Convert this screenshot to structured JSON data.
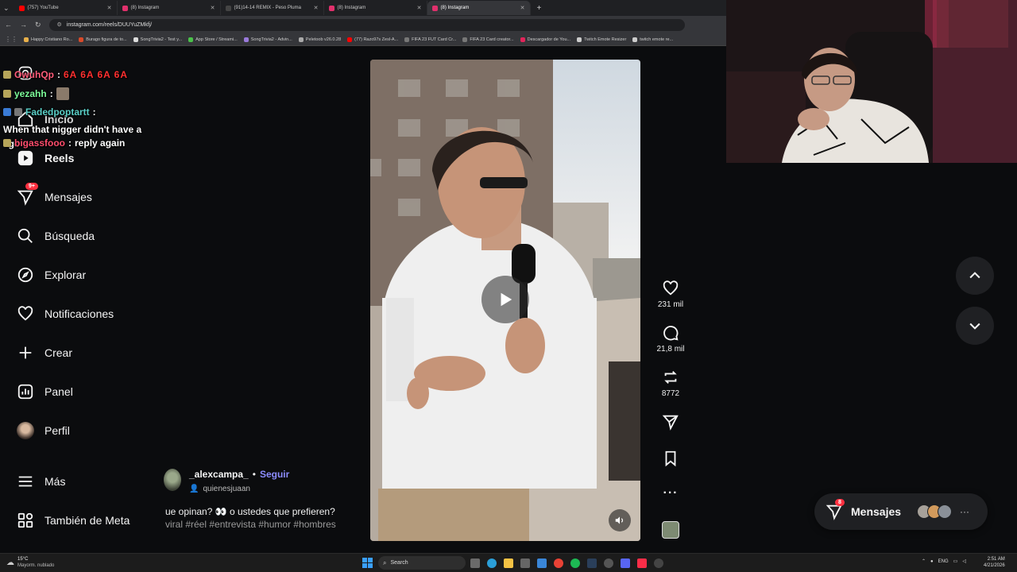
{
  "browser": {
    "tabs": [
      {
        "label": "(757) YouTube",
        "color": "#ff0000"
      },
      {
        "label": "(8) Instagram",
        "color": "#e1306c"
      },
      {
        "label": "(91)14-14 REMIX - Peso Pluma",
        "color": "#222222"
      },
      {
        "label": "(8) Instagram",
        "color": "#e1306c"
      },
      {
        "label": "(8) Instagram",
        "color": "#e1306c"
      }
    ],
    "new_tab": "+",
    "url": "instagram.com/reels/DUUYuZMkfj/",
    "bookmarks": [
      "Happy Cristiano Ro...",
      "Burago figura de to...",
      "SongTrivia2 - Test y...",
      "App Store / Streami...",
      "SongTrivia2 - Advin...",
      "Peletoob v26.0.28",
      "(77) Razo97s Zesl-A...",
      "FIFA 23 FUT Card Cr...",
      "FIFA 23 Card creator...",
      "Descargador de You...",
      "Twitch Emote Resizer",
      "twitch emote re..."
    ]
  },
  "sidebar": {
    "items": [
      {
        "label": "Inicio",
        "icon": "home-icon"
      },
      {
        "label": "Reels",
        "icon": "reels-icon"
      },
      {
        "label": "Mensajes",
        "icon": "messenger-icon",
        "badge": "9+"
      },
      {
        "label": "Búsqueda",
        "icon": "search-icon"
      },
      {
        "label": "Explorar",
        "icon": "compass-icon"
      },
      {
        "label": "Notificaciones",
        "icon": "heart-icon"
      },
      {
        "label": "Crear",
        "icon": "plus-icon"
      },
      {
        "label": "Panel",
        "icon": "chart-icon"
      },
      {
        "label": "Perfil",
        "icon": "avatar-icon"
      }
    ],
    "more": "Más",
    "meta": "También de Meta"
  },
  "chat": [
    {
      "user": "OwuhQp",
      "user_color": "#ff5c7a",
      "message": "6A 6A 6A 6A",
      "msg_color": "#ff3030"
    },
    {
      "user": "yezahh",
      "user_color": "#7CFC9A",
      "message": "",
      "msg_color": "#ffffff"
    },
    {
      "user": "Fadedpoptartt",
      "user_color": "#5ad0c8",
      "message": "When that nigger didn't have a ego",
      "msg_color": "#ffffff"
    },
    {
      "user": "bigassfooo",
      "user_color": "#ff4d6d",
      "message": "reply again",
      "msg_color": "#ffffff"
    }
  ],
  "post": {
    "author": "_alexcampa_",
    "separator": "•",
    "follow": "Seguir",
    "audio": "quienesjuaan",
    "caption_line1": "ue opinan? 👀 o ustedes que prefieren?",
    "caption_line2": "viral #réel #entrevista #humor #hombres"
  },
  "actions": {
    "likes": "231 mil",
    "comments": "21,8 mil",
    "reposts": "8772"
  },
  "messages_pill": {
    "label": "Mensajes",
    "badge": "8",
    "more": "···"
  },
  "taskbar": {
    "weather_temp": "15°C",
    "weather_desc": "Mayorm. nublado",
    "search": "Search",
    "lang": "ENG",
    "time": "2:51 AM",
    "date": "4/21/2026"
  },
  "colors": {
    "accent_follow": "#8c8cff",
    "badge": "#ff3040"
  }
}
